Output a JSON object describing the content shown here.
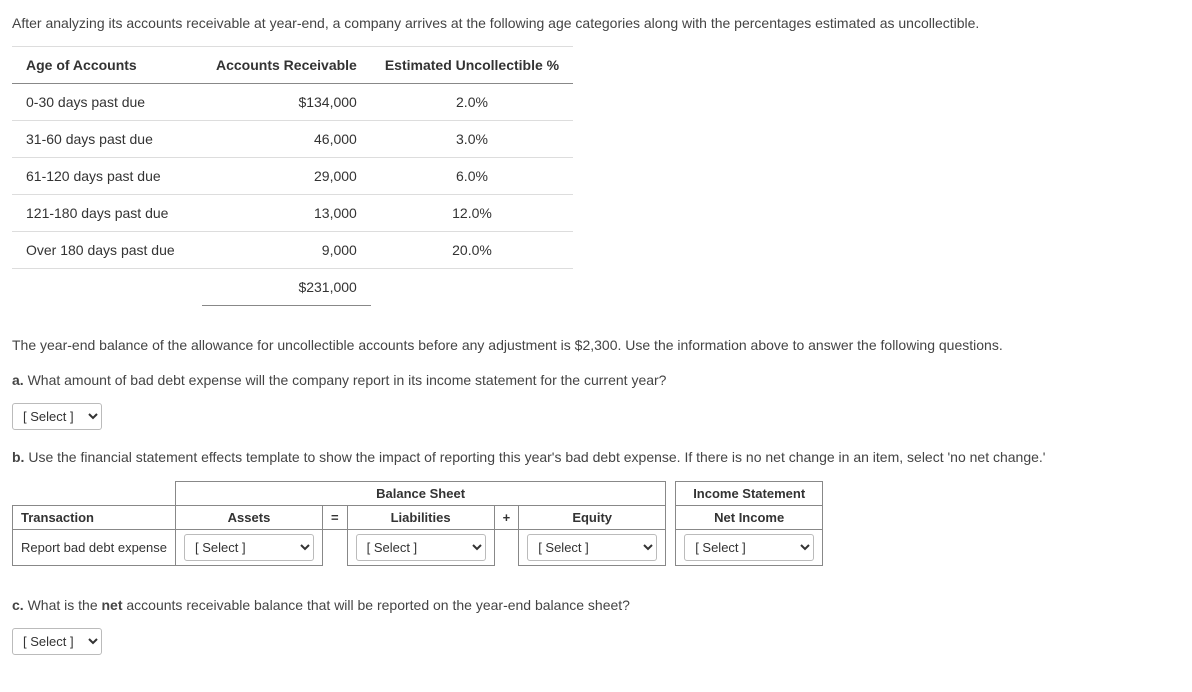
{
  "intro": "After analyzing its accounts receivable at year-end, a company arrives at the following age categories along with the percentages estimated as uncollectible.",
  "table": {
    "headers": {
      "age": "Age of Accounts",
      "ar": "Accounts Receivable",
      "pct": "Estimated Uncollectible %"
    },
    "rows": [
      {
        "age": "0-30 days past due",
        "ar": "$134,000",
        "pct": "2.0%"
      },
      {
        "age": "31-60 days past due",
        "ar": "46,000",
        "pct": "3.0%"
      },
      {
        "age": "61-120 days past due",
        "ar": "29,000",
        "pct": "6.0%"
      },
      {
        "age": "121-180 days past due",
        "ar": "13,000",
        "pct": "12.0%"
      },
      {
        "age": "Over 180 days past due",
        "ar": "9,000",
        "pct": "20.0%"
      }
    ],
    "total": "$231,000"
  },
  "mid": "The year-end balance of the allowance for uncollectible accounts before any adjustment is $2,300. Use the information above to answer the following questions.",
  "qa_label": "a.",
  "qa_text": " What amount of bad debt expense will the company report in its income statement for the current year?",
  "qb_label": "b.",
  "qb_text": " Use the financial statement effects template to show the impact of reporting this year's bad debt expense. If there is no net change in an item, select 'no net change.'",
  "qc_label": "c.",
  "qc_text": " What is the ",
  "qc_bold": "net",
  "qc_text2": " accounts receivable balance that will be reported on the year-end balance sheet?",
  "select_placeholder": "[ Select ]",
  "fs": {
    "bs": "Balance Sheet",
    "is": "Income Statement",
    "transaction": "Transaction",
    "assets": "Assets",
    "liabilities": "Liabilities",
    "equity": "Equity",
    "netincome": "Net Income",
    "rowlabel": "Report bad debt expense",
    "eq": "=",
    "plus": "+"
  }
}
